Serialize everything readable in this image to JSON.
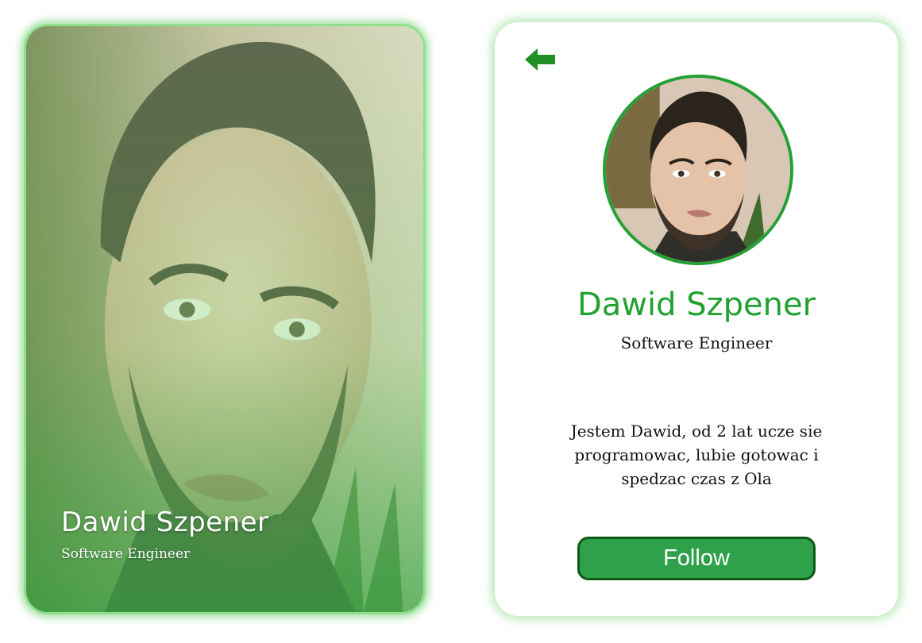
{
  "photo_card": {
    "name": "Dawid Szpener",
    "role": "Software Engineer"
  },
  "profile_card": {
    "back_icon": "arrow-left-icon",
    "name": "Dawid Szpener",
    "role": "Software Engineer",
    "bio": "Jestem Dawid, od 2 lat ucze sie programowac, lubie gotowac i spedzac czas z Ola",
    "follow_label": "Follow"
  },
  "colors": {
    "accent_green": "#21a12f",
    "button_green": "#2ea14a",
    "button_border": "#0d5a17",
    "glow_green": "#8ee08e"
  }
}
